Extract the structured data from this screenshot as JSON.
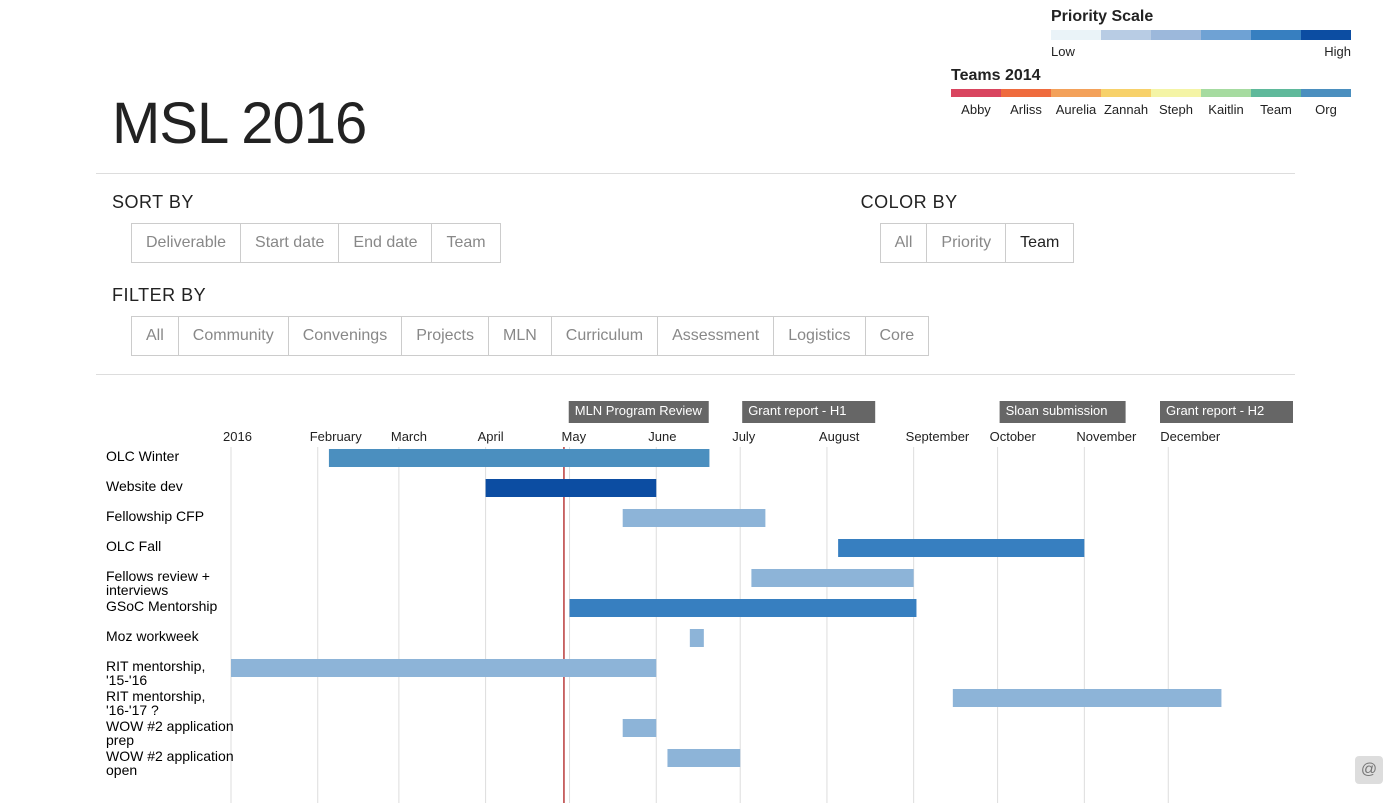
{
  "title": "MSL 2016",
  "priority_scale": {
    "title": "Priority Scale",
    "low": "Low",
    "high": "High",
    "colors": [
      "#eaf3f8",
      "#b8cce4",
      "#9cb8db",
      "#6fa2d4",
      "#377fc0",
      "#0c4da2"
    ]
  },
  "teams_legend": {
    "title": "Teams 2014",
    "items": [
      {
        "name": "Abby",
        "color": "#d9455f"
      },
      {
        "name": "Arliss",
        "color": "#ef6b3e"
      },
      {
        "name": "Aurelia",
        "color": "#f3a15a"
      },
      {
        "name": "Zannah",
        "color": "#f7d16a"
      },
      {
        "name": "Steph",
        "color": "#f4f4a6"
      },
      {
        "name": "Kaitlin",
        "color": "#a6dba0"
      },
      {
        "name": "Team",
        "color": "#5fb99b"
      },
      {
        "name": "Org",
        "color": "#4b8fbf"
      }
    ]
  },
  "controls": {
    "sort_by": {
      "label": "SORT BY",
      "options": [
        "Deliverable",
        "Start date",
        "End date",
        "Team"
      ],
      "active": null
    },
    "color_by": {
      "label": "COLOR BY",
      "options": [
        "All",
        "Priority",
        "Team"
      ],
      "active": "Team"
    },
    "filter_by": {
      "label": "FILTER BY",
      "options": [
        "All",
        "Community",
        "Convenings",
        "Projects",
        "MLN",
        "Curriculum",
        "Assessment",
        "Logistics",
        "Core"
      ],
      "active": null
    }
  },
  "chart_data": {
    "type": "gantt",
    "x_axis": {
      "start": "2016-01-01",
      "end": "2017-01-01",
      "ticks": [
        "2016",
        "February",
        "March",
        "April",
        "May",
        "June",
        "July",
        "August",
        "September",
        "October",
        "November",
        "December"
      ]
    },
    "today_marker": "2016-04-29",
    "milestones": [
      {
        "label": "MLN Program Review",
        "date": "2016-04-30"
      },
      {
        "label": "Grant report - H1",
        "date": "2016-07-01"
      },
      {
        "label": "Sloan submission",
        "date": "2016-10-01"
      },
      {
        "label": "Grant report - H2",
        "date": "2016-12-31"
      }
    ],
    "tasks": [
      {
        "name": "OLC Winter",
        "start": "2016-02-05",
        "end": "2016-06-20",
        "color": "#4b8fbf"
      },
      {
        "name": "Website dev",
        "start": "2016-04-01",
        "end": "2016-06-01",
        "color": "#0c4da2"
      },
      {
        "name": "Fellowship CFP",
        "start": "2016-05-20",
        "end": "2016-07-10",
        "color": "#8db4d8"
      },
      {
        "name": "OLC Fall",
        "start": "2016-08-05",
        "end": "2016-11-01",
        "color": "#377fc0"
      },
      {
        "name": "Fellows review + interviews",
        "start": "2016-07-05",
        "end": "2016-09-01",
        "color": "#8db4d8"
      },
      {
        "name": "GSoC Mentorship",
        "start": "2016-05-01",
        "end": "2016-09-02",
        "color": "#377fc0"
      },
      {
        "name": "Moz workweek",
        "start": "2016-06-13",
        "end": "2016-06-18",
        "color": "#8db4d8"
      },
      {
        "name": "RIT mentorship, '15-'16",
        "start": "2016-01-01",
        "end": "2016-06-01",
        "color": "#8db4d8"
      },
      {
        "name": "RIT mentorship, '16-'17 ?",
        "start": "2016-09-15",
        "end": "2016-12-20",
        "color": "#8db4d8"
      },
      {
        "name": "WOW #2 application prep",
        "start": "2016-05-20",
        "end": "2016-06-01",
        "color": "#8db4d8"
      },
      {
        "name": "WOW #2 application open",
        "start": "2016-06-05",
        "end": "2016-07-01",
        "color": "#8db4d8"
      }
    ]
  }
}
